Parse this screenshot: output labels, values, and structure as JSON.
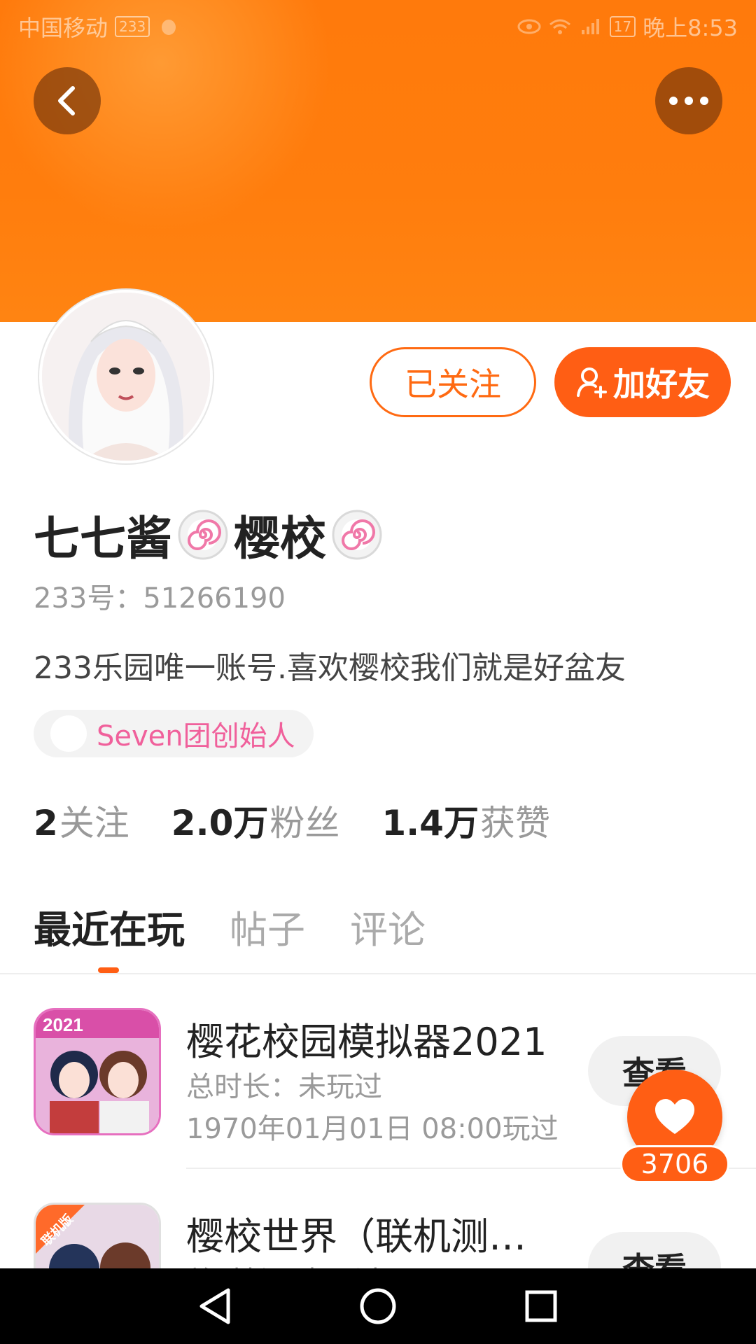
{
  "status_bar": {
    "carrier": "中国移动",
    "app_badge": "233",
    "battery": "17",
    "time": "晚上8:53"
  },
  "header": {
    "back_icon": "chevron-left-icon",
    "more_icon": "more-dots-icon"
  },
  "profile": {
    "follow_label": "已关注",
    "add_friend_label": "加好友",
    "nickname_part1": "七七酱",
    "nickname_part2": "樱校",
    "uid": "233号：51266190",
    "bio": "233乐园唯一账号.喜欢樱校我们就是好盆友",
    "tag": "Seven团创始人"
  },
  "stats": [
    {
      "value": "2",
      "label": "关注"
    },
    {
      "value": "2.0万",
      "label": "粉丝"
    },
    {
      "value": "1.4万",
      "label": "获赞"
    }
  ],
  "tabs": [
    {
      "label": "最近在玩",
      "active": true
    },
    {
      "label": "帖子",
      "active": false
    },
    {
      "label": "评论",
      "active": false
    }
  ],
  "games": [
    {
      "title": "樱花校园模拟器2021",
      "duration": "总时长：未玩过",
      "last_played": "1970年01月01日 08:00玩过",
      "button": "查看",
      "icon_badge": "2021"
    },
    {
      "title": "樱校世界（联机测…",
      "duration": "总时长：未玩过",
      "button": "查看",
      "icon_badge": "联机版"
    }
  ],
  "like_fab": {
    "count": "3706",
    "icon": "heart-icon"
  },
  "colors": {
    "accent": "#ff5e14",
    "banner": "#ff7a0c",
    "tag_text": "#f0609b"
  }
}
